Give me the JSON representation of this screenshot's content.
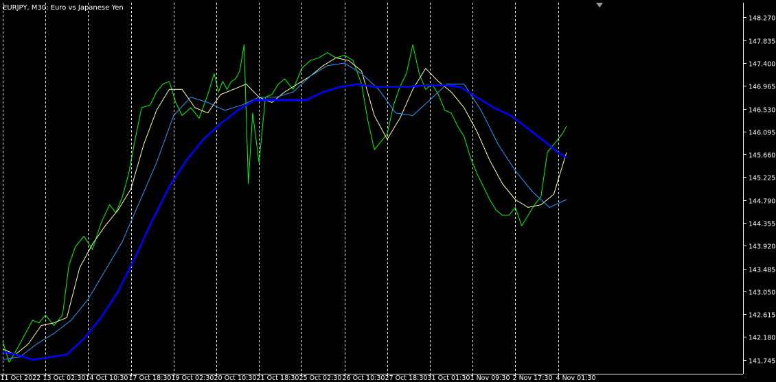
{
  "window": {
    "symbol": "EURJPY",
    "timeframe": "M30",
    "description": "Euro vs Japanese Yen",
    "title": "EURJPY, M30:  Euro vs Japanese Yen"
  },
  "colors": {
    "background": "#000000",
    "axis": "#ffffff",
    "grid": "#ffffff",
    "price_line": "#00ff00",
    "ma_fast": "#ffffaa",
    "ma_medium": "#3399ff",
    "ma_slow": "#0000ff",
    "text": "#ffffff"
  },
  "chart_data": {
    "type": "line",
    "x_tick_labels": [
      "11 Oct 2022",
      "13 Oct 02:30",
      "14 Oct 10:30",
      "17 Oct 18:30",
      "19 Oct 02:30",
      "20 Oct 10:30",
      "21 Oct 18:30",
      "25 Oct 02:30",
      "26 Oct 10:30",
      "27 Oct 18:30",
      "31 Oct 01:30",
      "1 Nov 09:30",
      "2 Nov 17:30",
      "4 Nov 01:30"
    ],
    "y_tick_labels": [
      "148.270",
      "147.835",
      "147.400",
      "146.965",
      "146.530",
      "146.095",
      "145.660",
      "145.225",
      "144.790",
      "144.355",
      "143.920",
      "143.485",
      "143.050",
      "142.615",
      "142.180",
      "141.745"
    ],
    "ylim": [
      141.48,
      148.55
    ],
    "x_range": [
      0,
      13.2
    ],
    "grid": "vertical-dashed",
    "series": [
      {
        "role": "price",
        "color": "#00ff00",
        "x": [
          0,
          0.15,
          0.3,
          0.5,
          0.7,
          0.85,
          1.0,
          1.2,
          1.4,
          1.55,
          1.7,
          1.9,
          2.1,
          2.3,
          2.5,
          2.65,
          2.8,
          2.95,
          3.1,
          3.25,
          3.45,
          3.6,
          3.75,
          3.9,
          4.05,
          4.2,
          4.4,
          4.6,
          4.8,
          4.95,
          5.05,
          5.15,
          5.25,
          5.35,
          5.45,
          5.55,
          5.65,
          5.75,
          5.85,
          6.0,
          6.15,
          6.3,
          6.45,
          6.6,
          6.8,
          7.0,
          7.2,
          7.4,
          7.6,
          7.8,
          8.0,
          8.2,
          8.4,
          8.55,
          8.7,
          8.85,
          9.0,
          9.15,
          9.3,
          9.45,
          9.6,
          9.75,
          9.9,
          10.05,
          10.2,
          10.35,
          10.5,
          10.65,
          10.8,
          10.95,
          11.1,
          11.25,
          11.4,
          11.55,
          11.7,
          11.85,
          12.0,
          12.15,
          12.3,
          12.45,
          12.6,
          12.75,
          12.95,
          13.1,
          13.2
        ],
        "y": [
          142.1,
          141.7,
          141.9,
          142.2,
          142.5,
          142.45,
          142.6,
          142.4,
          142.6,
          143.55,
          143.9,
          144.1,
          143.85,
          144.35,
          144.7,
          144.55,
          144.85,
          145.3,
          145.95,
          146.55,
          146.6,
          146.85,
          147.0,
          147.05,
          146.65,
          146.4,
          146.55,
          146.35,
          146.8,
          147.2,
          146.85,
          147.05,
          146.9,
          147.05,
          147.1,
          147.25,
          147.75,
          145.1,
          146.45,
          145.5,
          146.75,
          146.8,
          147.0,
          147.1,
          146.9,
          147.3,
          147.45,
          147.5,
          147.6,
          147.5,
          147.55,
          147.45,
          147.0,
          146.3,
          145.75,
          145.9,
          146.05,
          146.6,
          146.95,
          147.2,
          147.75,
          147.2,
          146.9,
          147.0,
          146.8,
          146.5,
          146.45,
          146.2,
          146.0,
          145.6,
          145.3,
          145.05,
          144.8,
          144.6,
          144.5,
          144.5,
          144.65,
          144.3,
          144.5,
          144.7,
          144.85,
          145.7,
          145.9,
          146.05,
          146.2
        ]
      },
      {
        "role": "moving-average-fast",
        "color": "#ffffaa",
        "x": [
          0,
          0.3,
          0.6,
          0.9,
          1.2,
          1.5,
          1.8,
          2.1,
          2.4,
          2.7,
          3.0,
          3.3,
          3.6,
          3.9,
          4.2,
          4.5,
          4.8,
          5.1,
          5.4,
          5.7,
          6.0,
          6.3,
          6.6,
          6.9,
          7.2,
          7.5,
          7.8,
          8.1,
          8.4,
          8.7,
          9.0,
          9.3,
          9.6,
          9.9,
          10.2,
          10.5,
          10.8,
          11.1,
          11.4,
          11.7,
          12.0,
          12.3,
          12.6,
          12.9,
          13.2
        ],
        "y": [
          141.95,
          141.85,
          142.05,
          142.4,
          142.45,
          142.55,
          143.5,
          143.95,
          144.3,
          144.6,
          145.0,
          145.85,
          146.5,
          146.9,
          146.9,
          146.55,
          146.45,
          146.8,
          146.9,
          147.0,
          146.75,
          146.65,
          146.85,
          147.0,
          147.15,
          147.35,
          147.5,
          147.45,
          147.25,
          146.4,
          145.95,
          146.35,
          146.9,
          147.3,
          147.05,
          146.85,
          146.55,
          146.1,
          145.55,
          145.1,
          144.8,
          144.65,
          144.7,
          144.9,
          145.7
        ]
      },
      {
        "role": "moving-average-medium",
        "color": "#3399ff",
        "x": [
          0,
          0.4,
          0.8,
          1.2,
          1.6,
          2.0,
          2.4,
          2.8,
          3.2,
          3.6,
          4.0,
          4.4,
          4.8,
          5.2,
          5.6,
          6.0,
          6.4,
          6.8,
          7.2,
          7.6,
          8.0,
          8.4,
          8.8,
          9.2,
          9.6,
          10.0,
          10.4,
          10.8,
          11.2,
          11.6,
          12.0,
          12.4,
          12.8,
          13.2
        ],
        "y": [
          141.75,
          141.8,
          142.05,
          142.25,
          142.5,
          142.9,
          143.45,
          144.0,
          144.75,
          145.5,
          146.4,
          146.75,
          146.65,
          146.5,
          146.6,
          146.75,
          146.75,
          146.85,
          147.15,
          147.35,
          147.4,
          147.2,
          146.9,
          146.45,
          146.4,
          146.7,
          147.0,
          147.0,
          146.5,
          145.85,
          145.35,
          144.95,
          144.65,
          144.8
        ]
      },
      {
        "role": "moving-average-slow",
        "color": "#0000ff",
        "x": [
          0,
          0.3,
          0.7,
          1.1,
          1.5,
          1.9,
          2.3,
          2.7,
          3.1,
          3.5,
          3.9,
          4.3,
          4.7,
          5.1,
          5.5,
          5.9,
          6.3,
          6.7,
          7.1,
          7.5,
          7.9,
          8.3,
          8.7,
          9.1,
          9.5,
          9.9,
          10.3,
          10.7,
          11.1,
          11.5,
          11.9,
          12.3,
          12.7,
          13.0,
          13.2
        ],
        "y": [
          141.9,
          141.85,
          141.75,
          141.8,
          141.85,
          142.15,
          142.55,
          143.05,
          143.7,
          144.4,
          145.05,
          145.55,
          145.95,
          146.25,
          146.5,
          146.7,
          146.7,
          146.7,
          146.7,
          146.85,
          146.95,
          147.0,
          146.95,
          146.95,
          146.95,
          146.98,
          146.98,
          146.95,
          146.75,
          146.55,
          146.4,
          146.15,
          145.9,
          145.7,
          145.6
        ]
      }
    ]
  }
}
